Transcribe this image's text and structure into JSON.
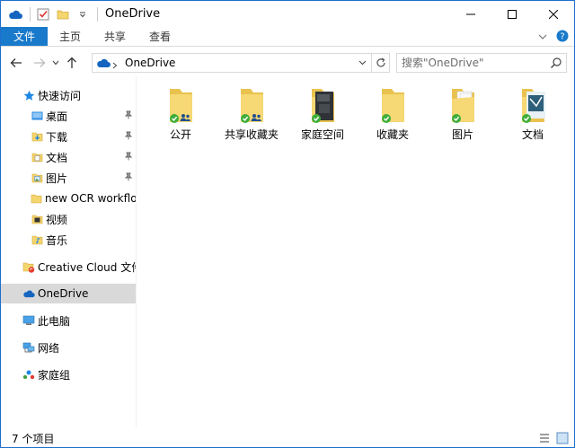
{
  "window": {
    "title": "OneDrive",
    "controls": {
      "minimize": "—",
      "maximize": "☐",
      "close": "✕"
    }
  },
  "ribbon": {
    "tabs": [
      "文件",
      "主页",
      "共享",
      "查看"
    ]
  },
  "address": {
    "path": "OneDrive",
    "search_placeholder": "搜索\"OneDrive\""
  },
  "nav": {
    "quick_access": "快速访问",
    "quick_items": [
      {
        "label": "桌面",
        "icon": "desktop-folder-icon",
        "pinned": true
      },
      {
        "label": "下载",
        "icon": "download-folder-icon",
        "pinned": true
      },
      {
        "label": "文档",
        "icon": "document-folder-icon",
        "pinned": true
      },
      {
        "label": "图片",
        "icon": "pictures-folder-icon",
        "pinned": true
      },
      {
        "label": "new OCR workflow",
        "icon": "folder-icon",
        "pinned": false
      },
      {
        "label": "视频",
        "icon": "video-folder-icon",
        "pinned": false
      },
      {
        "label": "音乐",
        "icon": "music-folder-icon",
        "pinned": false
      }
    ],
    "creative_cloud": "Creative Cloud 文件",
    "onedrive": "OneDrive",
    "this_pc": "此电脑",
    "network": "网络",
    "homegroup": "家庭组"
  },
  "folders": [
    {
      "label": "公开",
      "shared": true,
      "thumb": "none"
    },
    {
      "label": "共享收藏夹",
      "shared": true,
      "thumb": "none"
    },
    {
      "label": "家庭空间",
      "shared": false,
      "thumb": "dark"
    },
    {
      "label": "收藏夹",
      "shared": false,
      "thumb": "none"
    },
    {
      "label": "图片",
      "shared": false,
      "thumb": "pages"
    },
    {
      "label": "文档",
      "shared": false,
      "thumb": "photo"
    }
  ],
  "status": {
    "count": "7 个项目"
  },
  "colors": {
    "accent": "#1979ca",
    "folder": "#f5d56e",
    "sync_ok": "#3fae3a",
    "selected_bg": "#d9d9d9"
  }
}
